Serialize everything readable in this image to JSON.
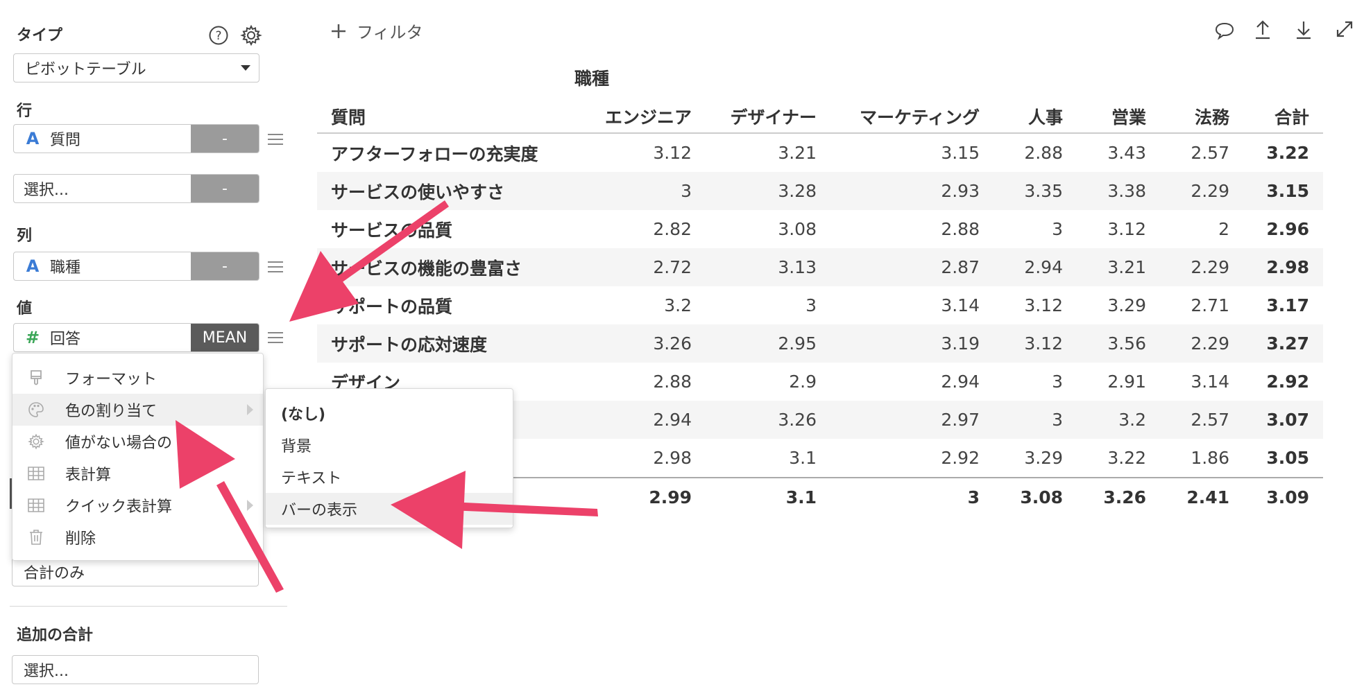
{
  "sidebar": {
    "type_label": "タイプ",
    "type_value": "ピボットテーブル",
    "row_label": "行",
    "row_field": {
      "type_glyph": "A",
      "name": "質問",
      "action": "-"
    },
    "row_select": {
      "placeholder": "選択...",
      "action": "-"
    },
    "col_label": "列",
    "col_field": {
      "type_glyph": "A",
      "name": "職種",
      "action": "-"
    },
    "val_label": "値",
    "val_field": {
      "type_glyph": "#",
      "name": "回答",
      "agg": "MEAN"
    },
    "totals_value": "合計のみ",
    "extra_totals_label": "追加の合計",
    "extra_select": "選択..."
  },
  "toolbar": {
    "filter_label": "フィルタ",
    "add_icon": "plus-icon"
  },
  "table": {
    "column_group": "職種",
    "row_header": "質問",
    "columns": [
      "エンジニア",
      "デザイナー",
      "マーケティング",
      "人事",
      "営業",
      "法務",
      "合計"
    ],
    "rows": [
      {
        "label": "アフターフォローの充実度",
        "values": [
          "3.12",
          "3.21",
          "3.15",
          "2.88",
          "3.43",
          "2.57",
          "3.22"
        ]
      },
      {
        "label": "サービスの使いやすさ",
        "values": [
          "3",
          "3.28",
          "2.93",
          "3.35",
          "3.38",
          "2.29",
          "3.15"
        ]
      },
      {
        "label": "サービスの品質",
        "values": [
          "2.82",
          "3.08",
          "2.88",
          "3",
          "3.12",
          "2",
          "2.96"
        ]
      },
      {
        "label": "サービスの機能の豊富さ",
        "values": [
          "2.72",
          "3.13",
          "2.87",
          "2.94",
          "3.21",
          "2.29",
          "2.98"
        ]
      },
      {
        "label": "サポートの品質",
        "values": [
          "3.2",
          "3",
          "3.14",
          "3.12",
          "3.29",
          "2.71",
          "3.17"
        ]
      },
      {
        "label": "サポートの応対速度",
        "values": [
          "3.26",
          "2.95",
          "3.19",
          "3.12",
          "3.56",
          "2.29",
          "3.27"
        ]
      },
      {
        "label": "デザイン",
        "values": [
          "2.88",
          "2.9",
          "2.94",
          "3",
          "2.91",
          "3.14",
          "2.92"
        ]
      },
      {
        "label": "",
        "values": [
          "2.94",
          "3.26",
          "2.97",
          "3",
          "3.2",
          "2.57",
          "3.07"
        ]
      },
      {
        "label": "",
        "values": [
          "2.98",
          "3.1",
          "2.92",
          "3.29",
          "3.22",
          "1.86",
          "3.05"
        ]
      }
    ],
    "totals": {
      "label": "",
      "values": [
        "2.99",
        "3.1",
        "3",
        "3.08",
        "3.26",
        "2.41",
        "3.09"
      ]
    }
  },
  "context_menu": {
    "items": [
      {
        "label": "フォーマット",
        "icon": "format-brush-icon"
      },
      {
        "label": "色の割り当て",
        "icon": "palette-icon"
      },
      {
        "label": "値がない場合の",
        "icon": "gear-icon"
      },
      {
        "label": "表計算",
        "icon": "table-icon"
      },
      {
        "label": "クイック表計算",
        "icon": "table-icon"
      },
      {
        "label": "削除",
        "icon": "trash-icon"
      }
    ]
  },
  "submenu": {
    "items": [
      "(なし)",
      "背景",
      "テキスト",
      "バーの表示"
    ]
  },
  "colors": {
    "arrow": "#ec4169",
    "string_type": "#3a7bd5",
    "number_type": "#3aa657"
  }
}
